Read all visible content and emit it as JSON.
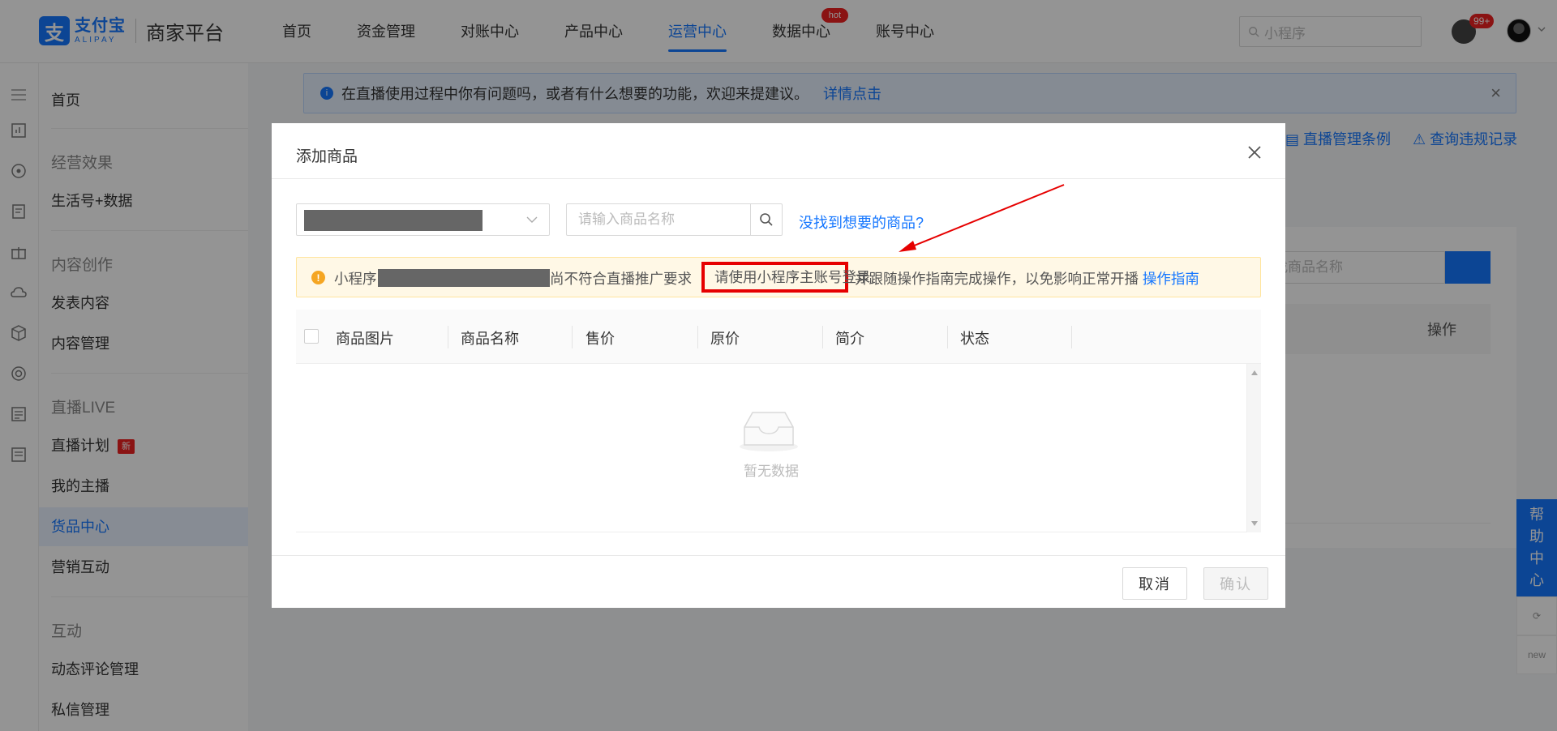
{
  "header": {
    "logo_cn": "支付宝",
    "logo_en": "ALIPAY",
    "platform": "商家平台",
    "nav": [
      {
        "label": "首页"
      },
      {
        "label": "资金管理"
      },
      {
        "label": "对账中心"
      },
      {
        "label": "产品中心"
      },
      {
        "label": "运营中心",
        "active": true
      },
      {
        "label": "数据中心",
        "badge": "hot"
      },
      {
        "label": "账号中心"
      }
    ],
    "search_placeholder": "小程序",
    "notification_count": "99+"
  },
  "sidebar": {
    "home": "首页",
    "groups": [
      {
        "title": "经营效果",
        "items": [
          "生活号+数据"
        ]
      },
      {
        "title": "内容创作",
        "items": [
          "发表内容",
          "内容管理"
        ]
      },
      {
        "title": "直播LIVE",
        "items": [
          "直播计划",
          "我的主播",
          "货品中心",
          "营销互动"
        ],
        "new_badge": "新",
        "active": "货品中心"
      },
      {
        "title": "互动",
        "items": [
          "动态评论管理",
          "私信管理"
        ]
      }
    ]
  },
  "main": {
    "banner_text": "在直播使用过程中你有问题吗，或者有什么想要的功能，欢迎来提建议。",
    "banner_link": "详情点击",
    "link_rules": "直播管理条例",
    "link_violations": "查询违规记录",
    "bg_search_placeholder": "找商品名称",
    "bg_col_op": "操作"
  },
  "help": {
    "label_chars": [
      "帮",
      "助",
      "中",
      "心"
    ],
    "new_label": "new"
  },
  "modal": {
    "title": "添加商品",
    "search_placeholder": "请输入商品名称",
    "not_found_link": "没找到想要的商品?",
    "warning": {
      "prefix": "小程序",
      "mid": "尚不符合直播推广要求",
      "highlight": "请使用小程序主账号登录,",
      "suffix": "并跟随操作指南完成操作，以免影响正常开播",
      "link": "操作指南"
    },
    "columns": [
      "商品图片",
      "商品名称",
      "售价",
      "原价",
      "简介",
      "状态"
    ],
    "empty_text": "暂无数据",
    "cancel": "取消",
    "confirm": "确认"
  },
  "colors": {
    "primary": "#1677ff",
    "annotation_red": "#e60000",
    "warning_bg": "#fff8e6"
  }
}
